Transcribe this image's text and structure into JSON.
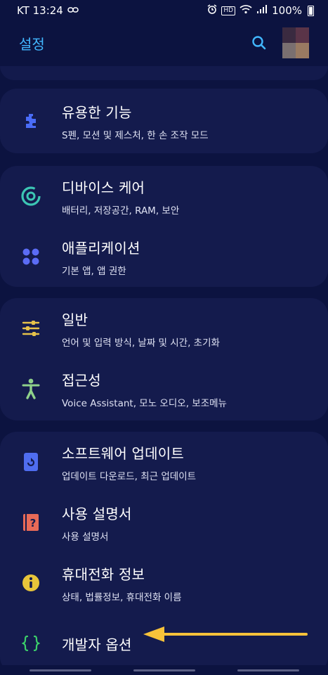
{
  "status_bar": {
    "carrier_time": "KT 13:24",
    "signal_label": "HD",
    "battery": "100%"
  },
  "header": {
    "title": "설정"
  },
  "sections": [
    {
      "items": [
        {
          "title": "유용한 기능",
          "subtitle": "S펜, 모션 및 제스처, 한 손 조작 모드",
          "icon": "puzzle-icon",
          "color": "#4a6cf7"
        }
      ]
    },
    {
      "items": [
        {
          "title": "디바이스 케어",
          "subtitle": "배터리, 저장공간, RAM, 보안",
          "icon": "device-care-icon",
          "color": "#3cc6b4"
        },
        {
          "title": "애플리케이션",
          "subtitle": "기본 앱, 앱 권한",
          "icon": "apps-grid-icon",
          "color": "#5b6cf5"
        }
      ]
    },
    {
      "items": [
        {
          "title": "일반",
          "subtitle": "언어 및 입력 방식, 날짜 및 시간, 초기화",
          "icon": "sliders-icon",
          "color": "#e6c24a"
        },
        {
          "title": "접근성",
          "subtitle": "Voice Assistant, 모노 오디오, 보조메뉴",
          "icon": "accessibility-icon",
          "color": "#8fd18a"
        }
      ]
    },
    {
      "items": [
        {
          "title": "소프트웨어 업데이트",
          "subtitle": "업데이트 다운로드, 최근 업데이트",
          "icon": "software-update-icon",
          "color": "#4f6df0"
        },
        {
          "title": "사용 설명서",
          "subtitle": "사용 설명서",
          "icon": "manual-icon",
          "color": "#e86a57"
        },
        {
          "title": "휴대전화 정보",
          "subtitle": "상태, 법률정보, 휴대전화 이름",
          "icon": "info-icon",
          "color": "#e8c53a"
        },
        {
          "title": "개발자 옵션",
          "subtitle": "",
          "icon": "developer-braces-icon",
          "color": "#3ccf6a"
        }
      ]
    }
  ],
  "colors": {
    "background": "#0c1340",
    "card": "#141b4d",
    "accent": "#42b7ff",
    "arrow": "#f7c23a"
  }
}
